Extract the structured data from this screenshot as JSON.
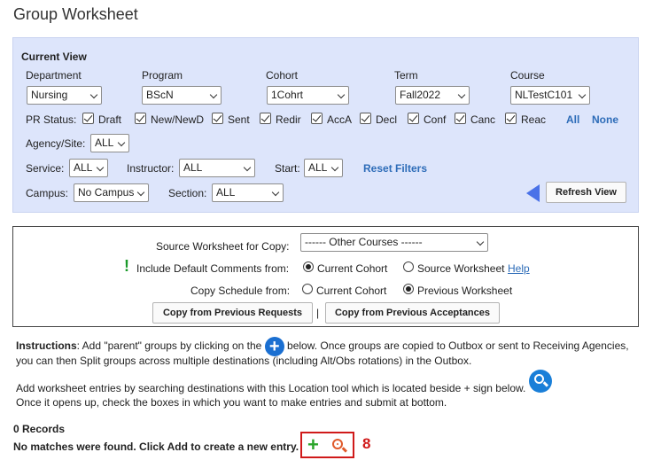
{
  "page": {
    "title": "Group Worksheet"
  },
  "current_view": {
    "heading": "Current View",
    "columns": {
      "department": {
        "label": "Department",
        "value": "Nursing"
      },
      "program": {
        "label": "Program",
        "value": "BScN"
      },
      "cohort": {
        "label": "Cohort",
        "value": "1Cohrt"
      },
      "term": {
        "label": "Term",
        "value": "Fall2022"
      },
      "course": {
        "label": "Course",
        "value": "NLTestC101"
      }
    },
    "pr_status": {
      "label": "PR Status:",
      "items": [
        "Draft",
        "New/NewD",
        "Sent",
        "Redir",
        "AccA",
        "Decl",
        "Conf",
        "Canc",
        "Reac"
      ],
      "all_link": "All",
      "none_link": "None"
    },
    "agency": {
      "label": "Agency/Site:",
      "value": "ALL"
    },
    "service": {
      "label": "Service:",
      "value": "ALL"
    },
    "instructor": {
      "label": "Instructor:",
      "value": "ALL"
    },
    "start": {
      "label": "Start:",
      "value": "ALL"
    },
    "reset_filters": "Reset Filters",
    "campus": {
      "label": "Campus:",
      "value": "No Campus"
    },
    "section": {
      "label": "Section:",
      "value": "ALL"
    },
    "refresh_button": "Refresh View"
  },
  "copy_panel": {
    "source_label": "Source Worksheet for Copy:",
    "source_value": "------ Other Courses ------",
    "include_label": "Include Default Comments from:",
    "include_options": [
      "Current Cohort",
      "Source Worksheet"
    ],
    "help_link": "Help",
    "schedule_label": "Copy Schedule from:",
    "schedule_options": [
      "Current Cohort",
      "Previous Worksheet"
    ],
    "btn_requests": "Copy from Previous Requests",
    "separator": "|",
    "btn_acceptances": "Copy from Previous Acceptances"
  },
  "instructions": {
    "lead": "Instructions",
    "line1_a": ":  Add \"parent\" groups by clicking on the",
    "line1_b": "below. Once groups are copied to Outbox or sent to Receiving Agencies,",
    "line2": "you can then Split groups across multiple destinations (including Alt/Obs rotations) in the Outbox.",
    "line3": "Add worksheet entries by searching destinations with this Location tool which is located beside + sign below.",
    "line4": "Once it opens up, check the boxes in which you want to make entries and submit at bottom."
  },
  "records": {
    "count": "0 Records",
    "message": "No matches were found. Click Add to create a new entry.",
    "annotation": "8"
  },
  "icons": [
    "plus-circle-icon",
    "location-search-icon",
    "add-plus-icon",
    "search-magnifier-icon",
    "refresh-arrow-icon",
    "exclamation-icon"
  ]
}
